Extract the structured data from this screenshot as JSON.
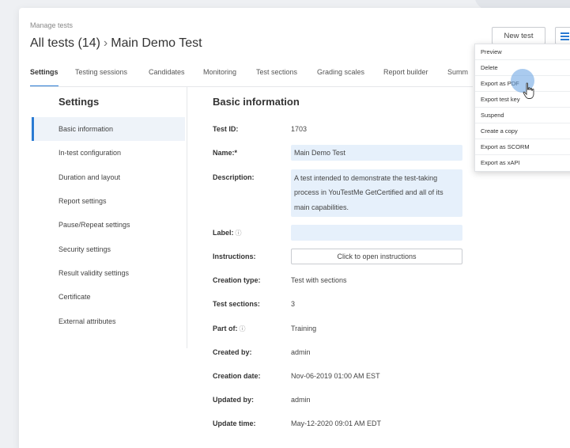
{
  "header": {
    "breadcrumb_small": "Manage tests",
    "title_part1": "All tests (14)",
    "title_sep": "›",
    "title_part2": "Main Demo Test",
    "new_test_label": "New test"
  },
  "tabs": [
    {
      "label": "Settings",
      "active": true
    },
    {
      "label": "Testing sessions"
    },
    {
      "label": "Candidates"
    },
    {
      "label": "Monitoring"
    },
    {
      "label": "Test sections"
    },
    {
      "label": "Grading scales"
    },
    {
      "label": "Report builder"
    },
    {
      "label": "Summ"
    }
  ],
  "sidebar": {
    "title": "Settings",
    "items": [
      {
        "label": "Basic information",
        "active": true
      },
      {
        "label": "In-test configuration"
      },
      {
        "label": "Duration and layout"
      },
      {
        "label": "Report settings"
      },
      {
        "label": "Pause/Repeat settings"
      },
      {
        "label": "Security settings"
      },
      {
        "label": "Result validity settings"
      },
      {
        "label": "Certificate"
      },
      {
        "label": "External attributes"
      }
    ]
  },
  "main": {
    "title": "Basic information",
    "fields": {
      "test_id": {
        "label": "Test ID:",
        "value": "1703"
      },
      "name": {
        "label": "Name:*",
        "value": "Main Demo Test"
      },
      "description": {
        "label": "Description:",
        "value_lines": [
          "A test intended to demonstrate the test-taking",
          "process in YouTestMe GetCertified and all of its",
          "main capabilities."
        ]
      },
      "label": {
        "label": "Label:",
        "value": ""
      },
      "instructions": {
        "label": "Instructions:",
        "button": "Click to open instructions"
      },
      "creation_type": {
        "label": "Creation type:",
        "value": "Test with sections"
      },
      "test_sections": {
        "label": "Test sections:",
        "value": "3"
      },
      "part_of": {
        "label": "Part of:",
        "value": "Training"
      },
      "created_by": {
        "label": "Created by:",
        "value": "admin"
      },
      "creation_date": {
        "label": "Creation date:",
        "value": "Nov-06-2019 01:00 AM EST"
      },
      "updated_by": {
        "label": "Updated by:",
        "value": "admin"
      },
      "update_time": {
        "label": "Update time:",
        "value": "May-12-2020 09:01 AM EDT"
      }
    },
    "help_icon": "?"
  },
  "dropdown": {
    "items": [
      "Preview",
      "Delete",
      "Export as PDF",
      "Export test key",
      "Suspend",
      "Create a copy",
      "Export as SCORM",
      "Export as xAPI"
    ],
    "hovered": "Export as PDF"
  },
  "colors": {
    "accent": "#2b7bd3",
    "field_bg": "#e6f0fb",
    "active_item_bg": "#eef3f9"
  },
  "icons": {
    "menu": "hamburger-menu-icon",
    "help": "help-circle-icon",
    "cursor": "hand-cursor-icon"
  }
}
